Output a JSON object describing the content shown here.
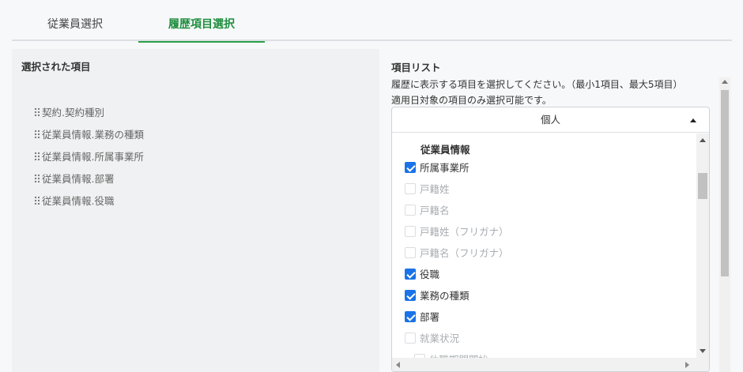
{
  "tabs": [
    {
      "label": "従業員選択",
      "active": false
    },
    {
      "label": "履歴項目選択",
      "active": true
    }
  ],
  "colors": {
    "accent": "#2aa048",
    "checkbox": "#1a73e8"
  },
  "left": {
    "heading": "選択された項目",
    "items": [
      "契約.契約種別",
      "従業員情報.業務の種類",
      "従業員情報.所属事業所",
      "従業員情報.部署",
      "従業員情報.役職"
    ]
  },
  "right": {
    "heading": "項目リスト",
    "desc1": "履歴に表示する項目を選択してください。（最小1項目、最大5項目）",
    "desc2": "適用日対象の項目のみ選択可能です。",
    "accordion": {
      "title": "個人",
      "group_label": "従業員情報",
      "options": [
        {
          "label": "所属事業所",
          "checked": true,
          "disabled": false
        },
        {
          "label": "戸籍姓",
          "checked": false,
          "disabled": true
        },
        {
          "label": "戸籍名",
          "checked": false,
          "disabled": true
        },
        {
          "label": "戸籍姓（フリガナ）",
          "checked": false,
          "disabled": true
        },
        {
          "label": "戸籍名（フリガナ）",
          "checked": false,
          "disabled": true
        },
        {
          "label": "役職",
          "checked": true,
          "disabled": false
        },
        {
          "label": "業務の種類",
          "checked": true,
          "disabled": false
        },
        {
          "label": "部署",
          "checked": true,
          "disabled": false
        },
        {
          "label": "就業状況",
          "checked": false,
          "disabled": true
        },
        {
          "label": "休職期間開始",
          "checked": false,
          "disabled": true
        }
      ]
    }
  }
}
